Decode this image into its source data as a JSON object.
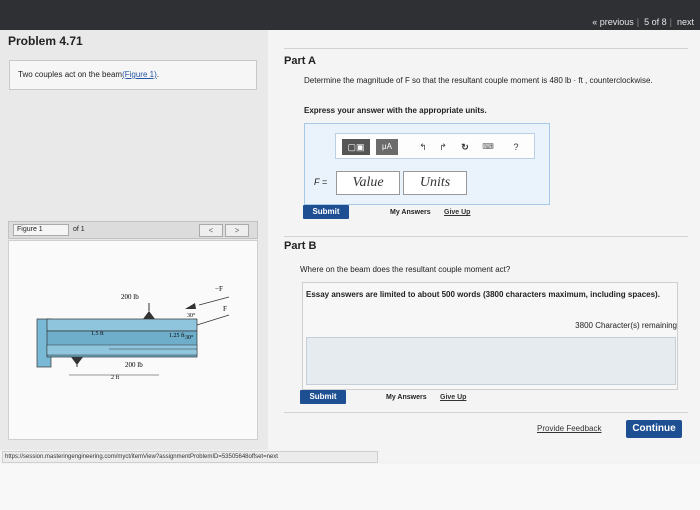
{
  "nav": {
    "previous": "« previous",
    "position": "5 of 8",
    "next": "next"
  },
  "problem": {
    "title": "Problem 4.71",
    "intro": "Two couples act on the beam",
    "figure_link": "(Figure 1)",
    "intro_end": "."
  },
  "figure_bar": {
    "select": "Figure 1",
    "of": "of 1",
    "prev": "<",
    "next": ">"
  },
  "figure": {
    "load_top": "200 lb",
    "load_bottom": "200 lb",
    "force_top": "F",
    "force_left": "−F",
    "dim_15": "1.5 ft",
    "dim_125": "1.25 ft",
    "dim_2": "2 ft",
    "angle_top": "30°",
    "angle_bottom": "30°"
  },
  "partA": {
    "title": "Part A",
    "question": "Determine the magnitude of F so that the resultant couple moment is 480 lb · ft , counterclockwise.",
    "instruction": "Express your answer with the appropriate units.",
    "toolbar": {
      "templates": "▢▣",
      "mu": "μA",
      "undo": "↰",
      "redo": "↱",
      "reset": "↻",
      "keyboard": "⌨",
      "help": "?"
    },
    "f_label": "F =",
    "value_placeholder": "Value",
    "units_placeholder": "Units",
    "submit": "Submit",
    "my_answers": "My Answers",
    "give_up": "Give Up"
  },
  "partB": {
    "title": "Part B",
    "question": "Where on the beam does the resultant couple moment act?",
    "essay_note": "Essay answers are limited to about 500 words (3800 characters maximum, including spaces).",
    "chars_remaining": "3800 Character(s) remaining",
    "submit": "Submit",
    "my_answers": "My Answers",
    "give_up": "Give Up"
  },
  "footer": {
    "feedback": "Provide Feedback",
    "continue": "Continue"
  },
  "status_url": "https://session.masteringengineering.com/myct/itemView?assignmentProblemID=53505648offset=next",
  "colors": {
    "primary_button": "#1e4f92",
    "top_bar": "#2e3034",
    "link": "#2656a8"
  }
}
